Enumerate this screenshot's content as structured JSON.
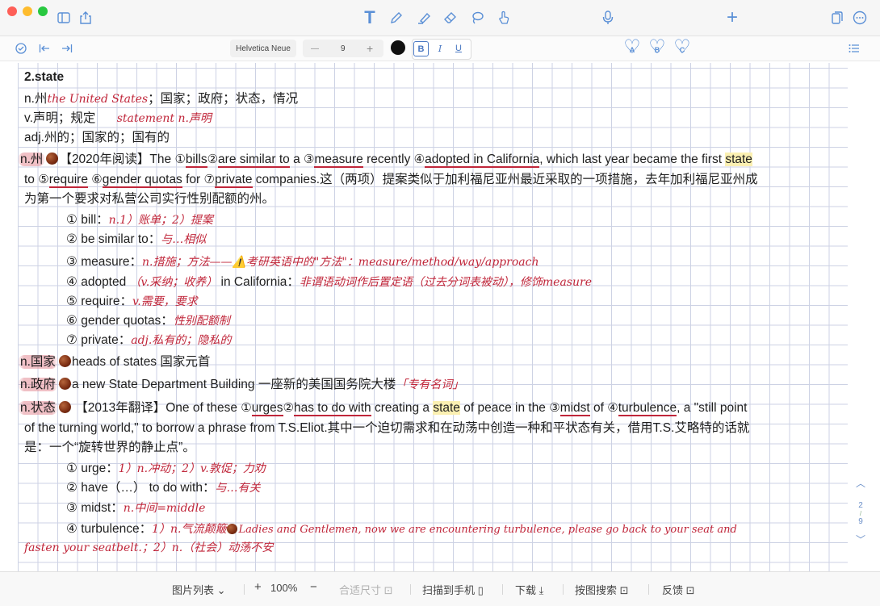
{
  "note": {
    "heading": "2.state",
    "l1": {
      "pre": "n.州",
      "hw": "the United States",
      "post": "；国家；政府；状态，情况"
    },
    "l2": {
      "pre": "v.声明；规定",
      "hw": "statement n.声明"
    },
    "l3": "adj.州的；国家的；国有的",
    "ex1": {
      "tag": "n.州",
      "a": "【2020年阅读】The ",
      "c1": "①",
      "w1": "bills",
      "c2": "②",
      "w2": "are similar to",
      "a2": " a ",
      "c3": "③",
      "w3": "measure",
      "a3": " recently ",
      "c4": "④",
      "w4": "adopted in California",
      "a4": ", which last year became the first ",
      "w_state": "state",
      "b": "to ",
      "c5": "⑤",
      "w5": "require",
      "b2": " ",
      "c6": "⑥",
      "w6": "gender quotas",
      "b3": " for ",
      "c7": "⑦",
      "w7": "private",
      "b4": " companies.这（两项）提案类似于加利福尼亚州最近采取的一项措施，去年加利福尼亚州成",
      "c": "为第一个要求对私营公司实行性别配额的州。"
    },
    "gloss1": [
      {
        "label": "① bill：",
        "hw": "n.1）账单；2）提案"
      },
      {
        "label": "② be similar to：",
        "hw": "与…相似"
      },
      {
        "label": "③ measure：",
        "hw": "n.措施；方法——⚠️考研英语中的\"方法\"：measure/method/way/approach"
      },
      {
        "label": "④ adopted ",
        "hw": "（v.采纳；收养）",
        "label2": " in California：",
        "hw2": "非谓语动词作后置定语（过去分词表被动），修饰measure"
      },
      {
        "label": "⑤ require：",
        "hw": "v.需要，要求"
      },
      {
        "label": "⑥ gender quotas：",
        "hw": "性别配额制"
      },
      {
        "label": "⑦ private：",
        "hw": "adj.私有的；隐私的"
      }
    ],
    "ex2": {
      "tag": "n.国家",
      "text": "heads of states 国家元首"
    },
    "ex3": {
      "tag": "n.政府",
      "text": "a new State Department Building 一座新的美国国务院大楼",
      "hw": "「专有名词」"
    },
    "ex4": {
      "tag": "n.状态",
      "a": " 【2013年翻译】One of these ",
      "c1": "①",
      "w1": "urges",
      "c2": "②",
      "w2": "has to do with",
      "a2": " creating a ",
      "w_state": "state",
      "a3": " of peace in the ",
      "c3": "③",
      "w3": "midst",
      "a4": " of ",
      "c4": "④",
      "w4": "turbulence",
      "a5": ", a \"still point",
      "b": "of the turning world,\" to borrow a phrase from T.S.Eliot.其中一个迫切需求和在动荡中创造一种和平状态有关，借用T.S.艾略特的话就",
      "c": "是：一个“旋转世界的静止点”。"
    },
    "gloss2": [
      {
        "label": "① urge：",
        "hw": "1）n.冲动；2）v.敦促；力劝"
      },
      {
        "label": "② have（…） to do with：",
        "hw": "与…有关"
      },
      {
        "label": "③ midst：",
        "hw": "n.中间=middle"
      },
      {
        "label": "④ turbulence：",
        "hw": "1）n.气流颠簸",
        "hw2": "Ladies and Gentlemen, now we are encountering turbulence, please go back to your seat and"
      }
    ],
    "last": {
      "hw": "fasten your seatbelt.；2）n.（社会）动荡不安"
    }
  },
  "format_bar": {
    "font": "Helvetica Neue",
    "minus": "—",
    "size": "9",
    "plus": "+",
    "bold": "B",
    "italic": "I",
    "underline": "U"
  },
  "hearts": [
    "A",
    "B",
    "C"
  ],
  "pager": {
    "up": "︿",
    "current": "2",
    "total": "9",
    "down": "﹀"
  },
  "bottom_bar": {
    "image_list": "图片列表 ⌄",
    "zoom_in": "+",
    "zoom": "100%",
    "zoom_out": "−",
    "fit": "合适尺寸 ⊡",
    "scan": "扫描到手机 ▯",
    "download": "下载 ⤓",
    "search_by_image": "按图搜索 ⊡",
    "feedback": "反馈 ⊡"
  },
  "colors": {
    "ink_red": "#c0263a",
    "accent_blue": "#5a8fd6",
    "highlight": "#fbf0b2",
    "grid": "#cdd2e4"
  }
}
